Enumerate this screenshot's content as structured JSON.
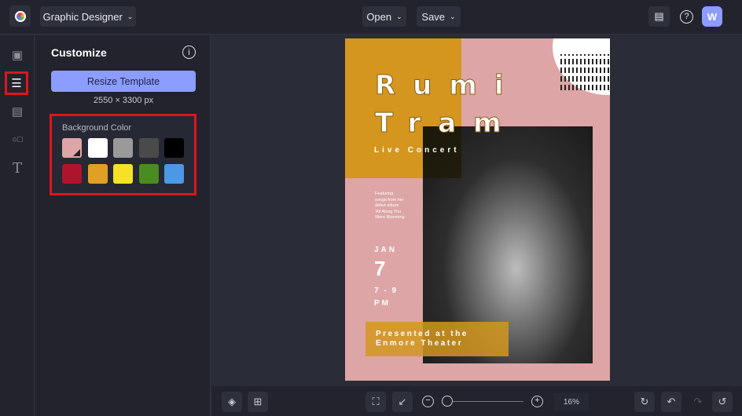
{
  "topbar": {
    "app_mode": "Graphic Designer",
    "open_label": "Open",
    "save_label": "Save",
    "avatar_initial": "W"
  },
  "panel": {
    "title": "Customize",
    "resize_label": "Resize Template",
    "dimensions": "2550 × 3300 px",
    "bg_color_label": "Background Color",
    "swatches": [
      "#dea5a6",
      "#ffffff",
      "#9a9a9a",
      "#4a4a4a",
      "#000000",
      "#b0142c",
      "#e0a024",
      "#f5e224",
      "#4a8c22",
      "#4a98e6"
    ]
  },
  "poster": {
    "title_line1": "Rumi",
    "title_line2": "Tram",
    "subtitle": "Live Concert",
    "description": "Featuring songs from her debut album 'All Along You Were Blooming",
    "month": "JAN",
    "day": "7",
    "time": "7 - 9",
    "ampm": "PM",
    "venue_line1": "Presented at the",
    "venue_line2": "Enmore Theater"
  },
  "bottombar": {
    "zoom": "16%",
    "zoom_fraction": 0.0
  },
  "colors": {
    "accent": "#8c9cff",
    "highlight": "#e0141c",
    "mustard": "#d4961e",
    "pink": "#dea5a6"
  }
}
